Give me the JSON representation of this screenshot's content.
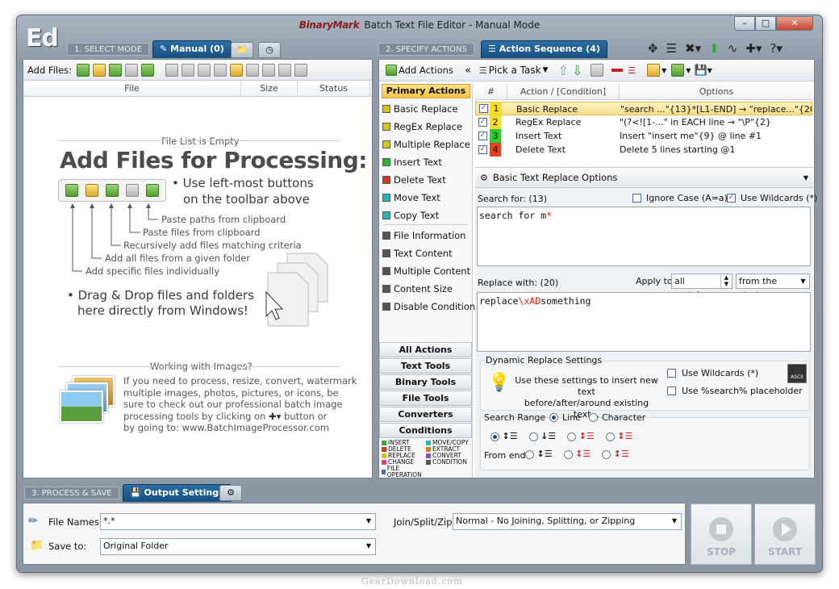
{
  "window": {
    "brand": "BinaryMark",
    "title": "Batch Text File Editor - Manual Mode",
    "logo": "Ed"
  },
  "step1": {
    "label": "1. SELECT MODE",
    "tab": "Manual (0)"
  },
  "step2": {
    "label": "2. SPECIFY ACTIONS",
    "tab": "Action Sequence (4)"
  },
  "step3": {
    "label": "3. PROCESS & SAVE",
    "tab": "Output Settings"
  },
  "files": {
    "add_label": "Add Files:",
    "columns": [
      "File",
      "Size",
      "Status"
    ],
    "empty_caption": "File List is Empty",
    "heading": "Add Files for Processing:",
    "tip1_l1": "• Use left-most buttons",
    "tip1_l2": "on the toolbar above",
    "hints": [
      "Paste paths from clipboard",
      "Paste files from clipboard",
      "Recursively add files matching criteria",
      "Add all files from a given folder",
      "Add specific files individually"
    ],
    "tip2_l1": "• Drag & Drop files and folders",
    "tip2_l2": "here directly from Windows!",
    "images_caption": "Working with Images?",
    "images_lines": [
      "If you need to process, resize, convert, watermark",
      "multiple images, photos, pictures, or icons, be",
      "sure to check out our professional batch image",
      "processing tools by clicking on",
      "by going to: www.BatchImageProcessor.com"
    ],
    "images_btn": "button or"
  },
  "actions_toolbar": {
    "add": "Add Actions",
    "collapse": "«",
    "pick": "Pick a Task"
  },
  "primary": {
    "header": "Primary Actions",
    "items": [
      {
        "label": "Basic Replace",
        "color": "#d4c41e"
      },
      {
        "label": "RegEx Replace",
        "color": "#d4c41e"
      },
      {
        "label": "Multiple Replace",
        "color": "#d4c41e"
      },
      {
        "label": "Insert Text",
        "color": "#2fb22f"
      },
      {
        "label": "Delete Text",
        "color": "#d0391e"
      },
      {
        "label": "Move Text",
        "color": "#2ab5c3"
      },
      {
        "label": "Copy Text",
        "color": "#2ab5c3"
      },
      {
        "label": "File Information",
        "color": "#555555"
      },
      {
        "label": "Text Content",
        "color": "#555555"
      },
      {
        "label": "Multiple Content",
        "color": "#555555"
      },
      {
        "label": "Content Size",
        "color": "#555555"
      },
      {
        "label": "Disable Condition",
        "color": "#555555"
      }
    ]
  },
  "categories": [
    "All Actions",
    "Text Tools",
    "Binary Tools",
    "File Tools",
    "Converters",
    "Conditions"
  ],
  "legend": [
    [
      "INSERT",
      "#2fb22f"
    ],
    [
      "MOVE/COPY",
      "#2ab5c3"
    ],
    [
      "DELETE",
      "#d0391e"
    ],
    [
      "EXTRACT",
      "#e07b1c"
    ],
    [
      "REPLACE",
      "#d4c41e"
    ],
    [
      "CONVERT",
      "#8a4fbf"
    ],
    [
      "CHANGE",
      "#e0417a"
    ],
    [
      "CONDITION",
      "#555555"
    ],
    [
      "FILE OPERATION",
      "#3a6fbf"
    ]
  ],
  "sequence": {
    "columns": [
      "#",
      "Action / [Condition]",
      "Options"
    ],
    "rows": [
      {
        "n": "1",
        "action": "Basic Replace",
        "options": "\"search ...\"{13}*[L1-END] → \"replace...\"{20}",
        "color": "#f5dc2a"
      },
      {
        "n": "2",
        "action": "RegEx Replace",
        "options": "\"(?<![1-...\" in EACH line → \"\\P\"{2}",
        "color": "#f5dc2a"
      },
      {
        "n": "3",
        "action": "Insert Text",
        "options": "Insert \"insert me\"{9} @ line #1",
        "color": "#2fcc2f"
      },
      {
        "n": "4",
        "action": "Delete Text",
        "options": "Delete 5 lines starting @1",
        "color": "#e0451e"
      }
    ]
  },
  "options": {
    "header": "Basic Text Replace Options",
    "search_for_label": "Search for: (13)",
    "ignore_case": "Ignore Case (A=a)",
    "use_wildcards": "Use Wildcards (*)",
    "search_value": "search for m",
    "search_star": "*",
    "replace_label": "Replace with: (20)",
    "apply_to": "Apply to:",
    "apply_value": "all matches",
    "from_value": "from the start",
    "replace_pre": "replace",
    "replace_esc": "\\xAD",
    "replace_post": "something",
    "dyn_title": "Dynamic Replace Settings",
    "dyn_text1": "Use these settings to insert new text",
    "dyn_text2": "before/after/around existing text...",
    "dyn_wild": "Use Wildcards (*)",
    "dyn_placeholder": "Use %search% placeholder",
    "range_label": "Search Range",
    "range_line": "Line",
    "range_char": "Character",
    "from_end": "From end:"
  },
  "output": {
    "file_names_label": "File Names:",
    "file_names_value": "*.*",
    "save_to_label": "Save to:",
    "save_to_value": "Original Folder",
    "join_label": "Join/Split/Zip:",
    "join_value": "Normal - No Joining, Splitting, or Zipping",
    "stop": "STOP",
    "start": "START"
  },
  "watermark": "GearDownload.com"
}
